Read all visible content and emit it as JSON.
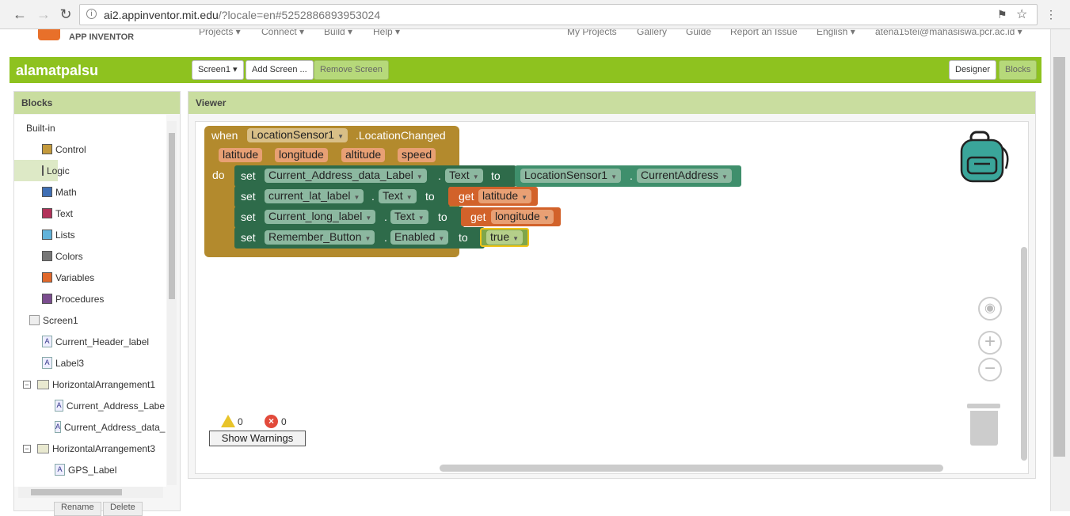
{
  "browser": {
    "url_host": "ai2.appinventor.mit.edu",
    "url_rest": "/?locale=en#5252886893953024"
  },
  "header": {
    "logo_text": "APP INVENTOR",
    "menus": [
      "Projects ▾",
      "Connect ▾",
      "Build ▾",
      "Help ▾"
    ],
    "right_menus": [
      "My Projects",
      "Gallery",
      "Guide",
      "Report an Issue",
      "English ▾",
      "atena15tei@mahasiswa.pcr.ac.id ▾"
    ]
  },
  "titlebar": {
    "project_name": "alamatpalsu",
    "screen_select": "Screen1 ▾",
    "add_screen": "Add Screen ...",
    "remove_screen": "Remove Screen",
    "designer": "Designer",
    "blocks": "Blocks"
  },
  "blocks_panel": {
    "title": "Blocks",
    "builtin_label": "Built-in",
    "builtin": [
      {
        "label": "Control",
        "color": "#c49a3c"
      },
      {
        "label": "Logic",
        "color": "#7fa64a"
      },
      {
        "label": "Math",
        "color": "#3f6fb5"
      },
      {
        "label": "Text",
        "color": "#b2325a"
      },
      {
        "label": "Lists",
        "color": "#62b3da"
      },
      {
        "label": "Colors",
        "color": "#777777"
      },
      {
        "label": "Variables",
        "color": "#e0682b"
      },
      {
        "label": "Procedures",
        "color": "#7b4d8f"
      }
    ],
    "components": {
      "screen": "Screen1",
      "label1": "Current_Header_label",
      "label2": "Label3",
      "arr1": "HorizontalArrangement1",
      "arr1_child1": "Current_Address_Labe",
      "arr1_child2": "Current_Address_data_",
      "arr3": "HorizontalArrangement3",
      "arr3_child1": "GPS_Label"
    },
    "bottom_buttons": [
      "Rename",
      "Delete"
    ]
  },
  "viewer": {
    "title": "Viewer",
    "event_block": {
      "when": "when",
      "component": "LocationSensor1",
      "event": ".LocationChanged",
      "params": [
        "latitude",
        "longitude",
        "altitude",
        "speed"
      ],
      "do": "do"
    },
    "statements": [
      {
        "set": "set",
        "component": "Current_Address_data_Label",
        "dot": ".",
        "prop": "Text",
        "to": "to",
        "value_component": "LocationSensor1",
        "value_prop": "CurrentAddress"
      },
      {
        "set": "set",
        "component": "current_lat_label",
        "dot": ".",
        "prop": "Text",
        "to": "to",
        "get": "get",
        "value": "latitude"
      },
      {
        "set": "set",
        "component": "Current_long_label",
        "dot": ".",
        "prop": "Text",
        "to": "to",
        "get": "get",
        "value": "longitude"
      },
      {
        "set": "set",
        "component": "Remember_Button",
        "dot": ".",
        "prop": "Enabled",
        "to": "to",
        "value": "true"
      }
    ],
    "warnings_count": "0",
    "errors_count": "0",
    "show_warnings": "Show Warnings"
  },
  "colors": {
    "event_block": "#b38a2d",
    "set_block": "#2e6b4a",
    "get_block": "#d2622a",
    "logic_block": "#7fa64a",
    "component_block": "#3f8f6c",
    "accent_green": "#8ec21f"
  }
}
